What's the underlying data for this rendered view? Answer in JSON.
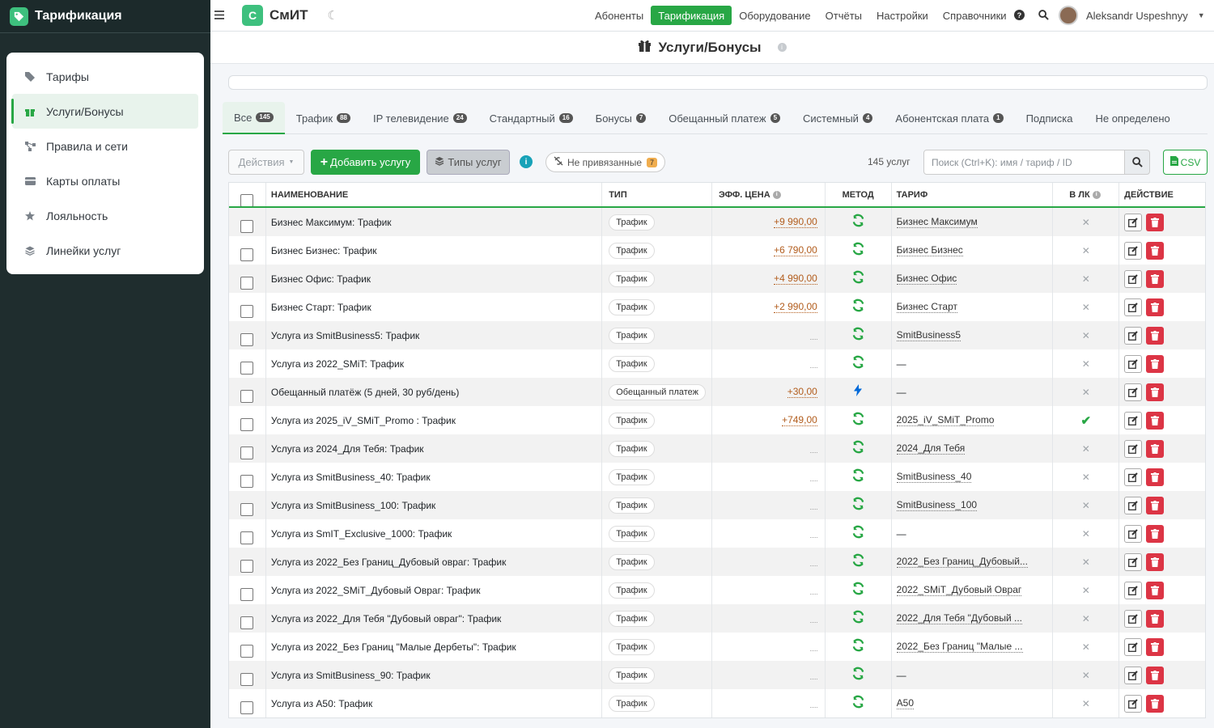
{
  "sidebar": {
    "brand": "Тарификация",
    "items": [
      {
        "label": "Тарифы",
        "icon": "tag-icon"
      },
      {
        "label": "Услуги/Бонусы",
        "icon": "gift-icon",
        "active": true
      },
      {
        "label": "Правила и сети",
        "icon": "network-icon"
      },
      {
        "label": "Карты оплаты",
        "icon": "card-icon"
      },
      {
        "label": "Лояльность",
        "icon": "star-icon"
      },
      {
        "label": "Линейки услуг",
        "icon": "layers-icon"
      }
    ]
  },
  "topbar": {
    "logo_letter": "С",
    "logo_text": "СмИТ",
    "nav": [
      {
        "label": "Абоненты"
      },
      {
        "label": "Тарификация",
        "active": true
      },
      {
        "label": "Оборудование"
      },
      {
        "label": "Отчёты"
      },
      {
        "label": "Настройки"
      },
      {
        "label": "Справочники"
      }
    ],
    "user_name": "Aleksandr Uspeshnyy"
  },
  "page": {
    "title": "Услуги/Бонусы"
  },
  "tabs": [
    {
      "label": "Все",
      "count": "145",
      "active": true
    },
    {
      "label": "Трафик",
      "count": "88"
    },
    {
      "label": "IP телевидение",
      "count": "24"
    },
    {
      "label": "Стандартный",
      "count": "16"
    },
    {
      "label": "Бонусы",
      "count": "7"
    },
    {
      "label": "Обещанный платеж",
      "count": "5"
    },
    {
      "label": "Системный",
      "count": "4"
    },
    {
      "label": "Абонентская плата",
      "count": "1"
    },
    {
      "label": "Подписка",
      "count": ""
    },
    {
      "label": "Не определено",
      "count": ""
    }
  ],
  "toolbar": {
    "actions_label": "Действия",
    "add_label": "Добавить услугу",
    "types_label": "Типы услуг",
    "unbound_label": "Не привязанные",
    "unbound_count": "7",
    "total_text": "145 услуг",
    "search_placeholder": "Поиск (Ctrl+K): имя / тариф / ID",
    "csv_label": "CSV"
  },
  "table": {
    "headers": {
      "name": "НАИМЕНОВАНИЕ",
      "type": "ТИП",
      "price": "ЭФФ. ЦЕНА",
      "method": "МЕТОД",
      "tariff": "ТАРИФ",
      "lk": "В ЛК",
      "action": "ДЕЙСТВИЕ"
    },
    "rows": [
      {
        "name": "Бизнес Максимум: Трафик",
        "type": "Трафик",
        "price": "+9 990,00",
        "method": "refresh",
        "tariff": "Бизнес Максимум",
        "lk": false
      },
      {
        "name": "Бизнес Бизнес: Трафик",
        "type": "Трафик",
        "price": "+6 790,00",
        "method": "refresh",
        "tariff": "Бизнес Бизнес",
        "lk": false
      },
      {
        "name": "Бизнес Офис: Трафик",
        "type": "Трафик",
        "price": "+4 990,00",
        "method": "refresh",
        "tariff": "Бизнес Офис",
        "lk": false
      },
      {
        "name": "Бизнес Старт: Трафик",
        "type": "Трафик",
        "price": "+2 990,00",
        "method": "refresh",
        "tariff": "Бизнес Старт",
        "lk": false
      },
      {
        "name": "Услуга из SmitBusiness5: Трафик",
        "type": "Трафик",
        "price": "",
        "method": "refresh",
        "tariff": "SmitBusiness5",
        "lk": false
      },
      {
        "name": "Услуга из 2022_SMiT: Трафик",
        "type": "Трафик",
        "price": "",
        "method": "refresh",
        "tariff": "—",
        "lk": false
      },
      {
        "name": "Обещанный платёж (5 дней, 30 руб/день)",
        "type": "Обещанный платеж",
        "price": "+30,00",
        "method": "bolt",
        "tariff": "—",
        "lk": false
      },
      {
        "name": "Услуга из 2025_iV_SMiT_Promo : Трафик",
        "type": "Трафик",
        "price": "+749,00",
        "method": "refresh",
        "tariff": "2025_iV_SMiT_Promo",
        "lk": true
      },
      {
        "name": "Услуга из 2024_Для Тебя: Трафик",
        "type": "Трафик",
        "price": "",
        "method": "refresh",
        "tariff": "2024_Для Тебя",
        "lk": false
      },
      {
        "name": "Услуга из SmitBusiness_40: Трафик",
        "type": "Трафик",
        "price": "",
        "method": "refresh",
        "tariff": "SmitBusiness_40",
        "lk": false
      },
      {
        "name": "Услуга из SmitBusiness_100: Трафик",
        "type": "Трафик",
        "price": "",
        "method": "refresh",
        "tariff": "SmitBusiness_100",
        "lk": false
      },
      {
        "name": "Услуга из SmIT_Exclusive_1000: Трафик",
        "type": "Трафик",
        "price": "",
        "method": "refresh",
        "tariff": "—",
        "lk": false
      },
      {
        "name": "Услуга из 2022_Без Границ_Дубовый овраг: Трафик",
        "type": "Трафик",
        "price": "",
        "method": "refresh",
        "tariff": "2022_Без Границ_Дубовый...",
        "lk": false
      },
      {
        "name": "Услуга из 2022_SMiT_Дубовый Овраг: Трафик",
        "type": "Трафик",
        "price": "",
        "method": "refresh",
        "tariff": "2022_SMiT_Дубовый Овраг",
        "lk": false
      },
      {
        "name": "Услуга из 2022_Для Тебя \"Дубовый овраг\": Трафик",
        "type": "Трафик",
        "price": "",
        "method": "refresh",
        "tariff": "2022_Для Тебя \"Дубовый ...",
        "lk": false
      },
      {
        "name": "Услуга из 2022_Без Границ \"Малые Дербеты\": Трафик",
        "type": "Трафик",
        "price": "",
        "method": "refresh",
        "tariff": "2022_Без Границ \"Малые ...",
        "lk": false
      },
      {
        "name": "Услуга из SmitBusiness_90: Трафик",
        "type": "Трафик",
        "price": "",
        "method": "refresh",
        "tariff": "—",
        "lk": false
      },
      {
        "name": "Услуга из A50: Трафик",
        "type": "Трафик",
        "price": "",
        "method": "refresh",
        "tariff": "A50",
        "lk": false
      }
    ]
  },
  "colors": {
    "accent": "#28a745",
    "sidebar_bg": "#1f2d2e",
    "danger": "#dc3545",
    "price": "#b25c1c"
  }
}
